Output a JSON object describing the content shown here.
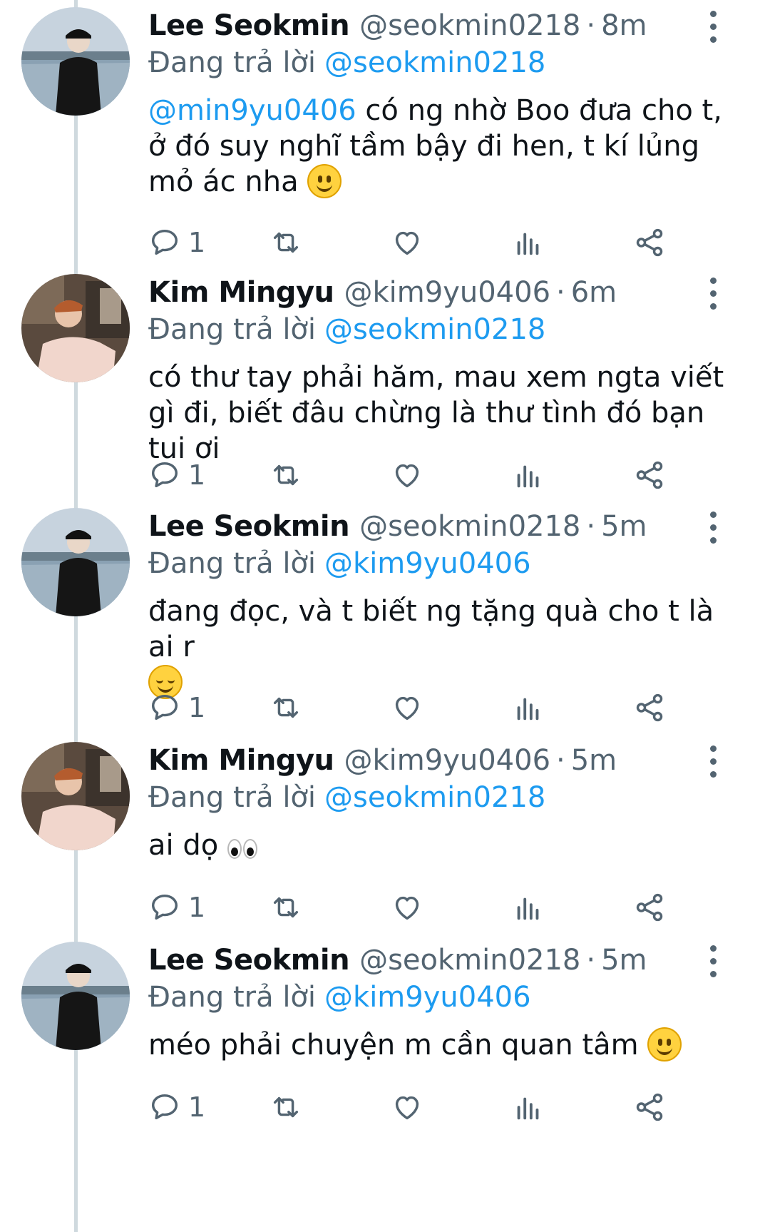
{
  "replying_prefix": "Đang trả lời",
  "tweets": [
    {
      "author_name": "Lee Seokmin",
      "handle": "@seokmin0218",
      "time": "8m",
      "replying_to": "@seokmin0218",
      "text_mention": "@min9yu0406",
      "text": "có ng nhờ Boo đưa cho t, ở đó suy nghĩ tầm bậy đi hen, t kí lủng mỏ ác nha",
      "emoji": "slightly-smiling-face",
      "reply_count": "1",
      "avatar": "lee-seokmin"
    },
    {
      "author_name": "Kim Mingyu",
      "handle": "@kim9yu0406",
      "time": "6m",
      "replying_to": "@seokmin0218",
      "text_mention": "",
      "text": "có thư tay phải hăm, mau xem ngta viết gì đi, biết đâu chừng là thư tình đó bạn tui ơi",
      "emoji": "",
      "reply_count": "1",
      "avatar": "kim-mingyu"
    },
    {
      "author_name": "Lee Seokmin",
      "handle": "@seokmin0218",
      "time": "5m",
      "replying_to": "@kim9yu0406",
      "text_mention": "",
      "text": "đang đọc, và t biết ng tặng quà cho t là ai r",
      "emoji": "smiling-face-blush",
      "reply_count": "1",
      "avatar": "lee-seokmin"
    },
    {
      "author_name": "Kim Mingyu",
      "handle": "@kim9yu0406",
      "time": "5m",
      "replying_to": "@seokmin0218",
      "text_mention": "",
      "text": "ai dọ",
      "emoji": "eyes",
      "reply_count": "1",
      "avatar": "kim-mingyu"
    },
    {
      "author_name": "Lee Seokmin",
      "handle": "@seokmin0218",
      "time": "5m",
      "replying_to": "@kim9yu0406",
      "text_mention": "",
      "text": "méo phải chuyện m cần quan tâm",
      "emoji": "slightly-smiling-face",
      "reply_count": "1",
      "avatar": "lee-seokmin"
    }
  ],
  "icons": {
    "reply": "reply-icon",
    "retweet": "retweet-icon",
    "like": "heart-icon",
    "views": "views-icon",
    "share": "share-icon",
    "more": "more-vertical-icon"
  },
  "colors": {
    "link": "#1d9bf0",
    "secondary_text": "#536471",
    "thread_line": "#cfd9de"
  }
}
